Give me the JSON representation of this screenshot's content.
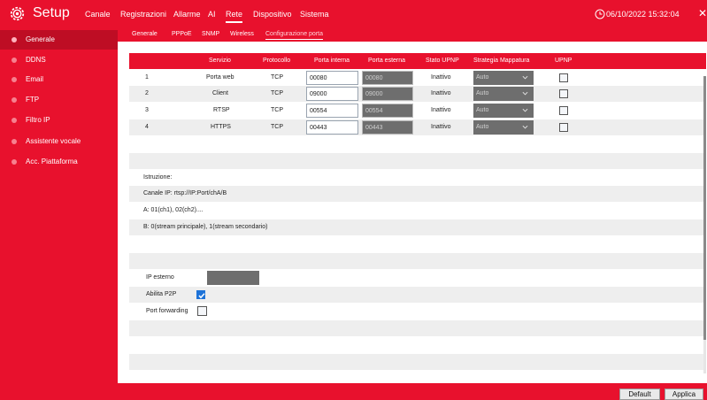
{
  "header": {
    "title": "Setup",
    "nav": [
      "Canale",
      "Registrazioni",
      "Allarme",
      "AI",
      "Rete",
      "Dispositivo",
      "Sistema"
    ],
    "active_nav": "Rete",
    "datetime": "06/10/2022 15:32:04",
    "close_label": "✕"
  },
  "sidebar": {
    "items": [
      "Generale",
      "DDNS",
      "Email",
      "FTP",
      "Filtro IP",
      "Assistente vocale",
      "Acc. Piattaforma"
    ],
    "active": "Generale"
  },
  "subtabs": {
    "items": [
      "Generale",
      "PPPoE",
      "SNMP",
      "Wireless",
      "Configurazione porta"
    ],
    "active": "Configurazione porta"
  },
  "table": {
    "headers": [
      "Servizio",
      "Protocollo",
      "Porta interna",
      "Porta esterna",
      "Stato UPNP",
      "Strategia Mappatura",
      "UPNP"
    ],
    "rows": [
      {
        "num": "1",
        "service": "Porta web",
        "protocol": "TCP",
        "internal": "00080",
        "external": "00080",
        "status": "Inattivo",
        "strategy": "Auto",
        "upnp": false
      },
      {
        "num": "2",
        "service": "Client",
        "protocol": "TCP",
        "internal": "09000",
        "external": "09000",
        "status": "Inattivo",
        "strategy": "Auto",
        "upnp": false
      },
      {
        "num": "3",
        "service": "RTSP",
        "protocol": "TCP",
        "internal": "00554",
        "external": "00554",
        "status": "Inattivo",
        "strategy": "Auto",
        "upnp": false
      },
      {
        "num": "4",
        "service": "HTTPS",
        "protocol": "TCP",
        "internal": "00443",
        "external": "00443",
        "status": "Inattivo",
        "strategy": "Auto",
        "upnp": false
      }
    ]
  },
  "instructions": {
    "heading": "Istruzione:",
    "line1": "Canale IP:  rtsp://IP:Port/chA/B",
    "line2": "A: 01(ch1), 02(ch2)....",
    "line3": "B: 0(stream principale), 1(stream secondario)"
  },
  "network": {
    "external_ip_label": "IP esterno",
    "external_ip_value": "",
    "p2p_label": "Abilita P2P",
    "p2p_enabled": true,
    "port_forward_label": "Port forwarding",
    "port_forward_enabled": false
  },
  "footer": {
    "default_label": "Default",
    "apply_label": "Applica"
  },
  "colors": {
    "brand": "#e8112d",
    "sidebar_active": "#be0d24",
    "checkbox_on": "#1e73d8"
  }
}
